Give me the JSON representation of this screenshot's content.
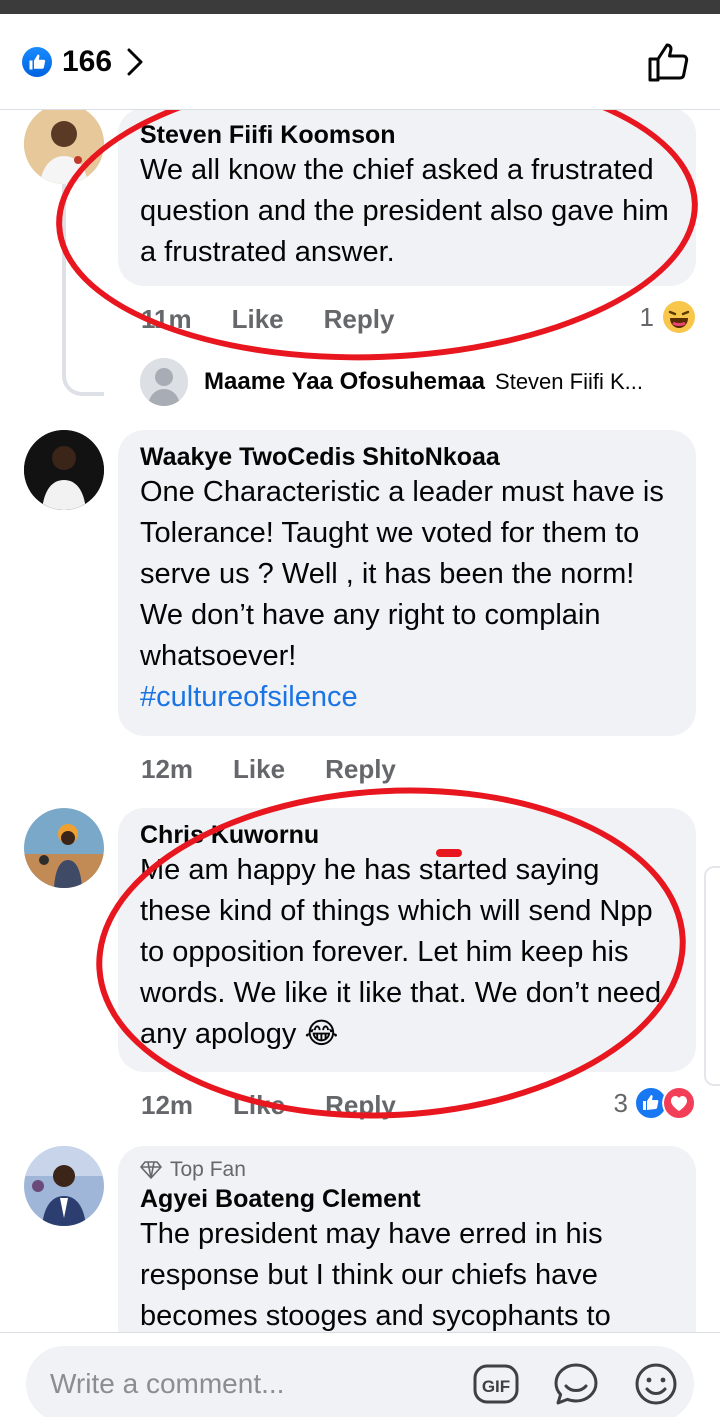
{
  "header": {
    "reaction_count": "166"
  },
  "comments": [
    {
      "author": "Steven Fiifi Koomson",
      "text": "We all know the chief asked a frustrated question and the president also gave him a frustrated answer.",
      "time": "11m",
      "like": "Like",
      "reply": "Reply",
      "reaction_count": "1"
    },
    {
      "author": "Waakye TwoCedis ShitoNkoaa",
      "text": "One Characteristic a leader must have is Tolerance! Taught we voted for them to serve us ? Well , it has been the norm! We don’t have any right to complain whatsoever!",
      "hashtag": "#cultureofsilence",
      "time": "12m",
      "like": "Like",
      "reply": "Reply"
    },
    {
      "author": "Chris Kuwornu",
      "text": "Me am happy he has started saying these kind of things which will send Npp to opposition forever. Let him keep his words. We like it like that. We don’t need any apology 😂",
      "time": "12m",
      "like": "Like",
      "reply": "Reply",
      "reaction_count": "3"
    },
    {
      "badge": "Top Fan",
      "author": "Agyei Boateng Clement",
      "text": "The president may have erred in his response but I think our chiefs have becomes stooges and sycophants to"
    }
  ],
  "reply_preview": {
    "author": "Maame Yaa Ofosuhemaa",
    "snippet": "Steven Fiifi K..."
  },
  "composer": {
    "placeholder": "Write a comment..."
  },
  "colors": {
    "accent": "#1b74e4",
    "annotation": "#e8161f"
  }
}
